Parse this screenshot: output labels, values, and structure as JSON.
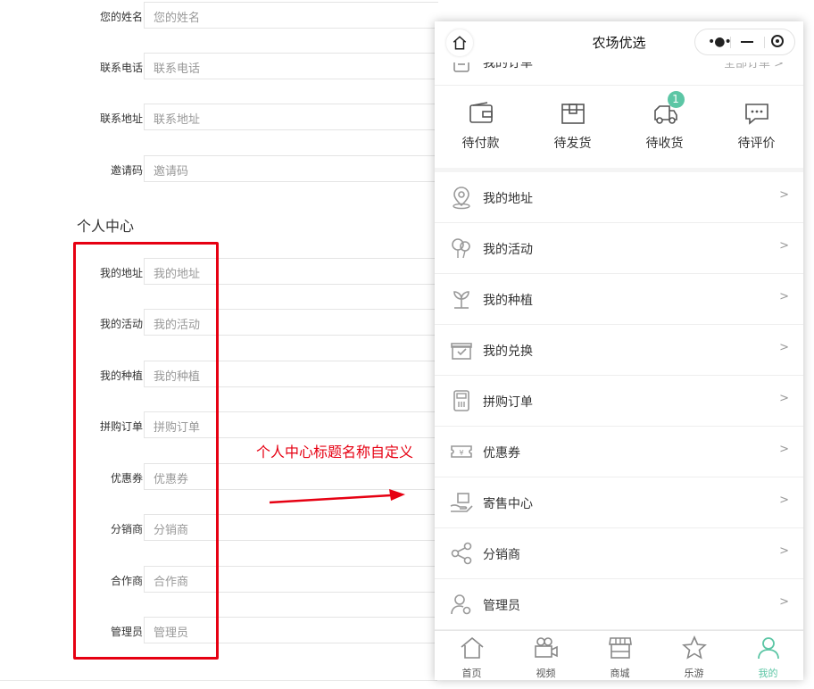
{
  "form": {
    "fields": [
      {
        "label": "您的姓名",
        "placeholder": "您的姓名"
      },
      {
        "label": "联系电话",
        "placeholder": "联系电话"
      },
      {
        "label": "联系地址",
        "placeholder": "联系地址"
      },
      {
        "label": "邀请码",
        "placeholder": "邀请码"
      }
    ],
    "section_title": "个人中心",
    "center_fields": [
      {
        "label": "我的地址",
        "placeholder": "我的地址"
      },
      {
        "label": "我的活动",
        "placeholder": "我的活动"
      },
      {
        "label": "我的种植",
        "placeholder": "我的种植"
      },
      {
        "label": "拼购订单",
        "placeholder": "拼购订单"
      },
      {
        "label": "优惠券",
        "placeholder": "优惠券"
      },
      {
        "label": "分销商",
        "placeholder": "分销商"
      },
      {
        "label": "合作商",
        "placeholder": "合作商"
      },
      {
        "label": "管理员",
        "placeholder": "管理员"
      }
    ]
  },
  "annotation": {
    "text": "个人中心标题名称自定义",
    "color": "#e60012"
  },
  "phone": {
    "title": "农场优选",
    "order_header": {
      "title": "我的订单",
      "all": "全部订单 >"
    },
    "orders": [
      {
        "label": "待付款",
        "icon": "wallet-icon"
      },
      {
        "label": "待发货",
        "icon": "package-icon"
      },
      {
        "label": "待收货",
        "icon": "delivery-truck-icon",
        "badge": "1"
      },
      {
        "label": "待评价",
        "icon": "comment-icon"
      }
    ],
    "menu": [
      {
        "label": "我的地址",
        "arrow": ">",
        "icon": "location-icon"
      },
      {
        "label": "我的活动",
        "arrow": ">",
        "icon": "balloon-icon"
      },
      {
        "label": "我的种植",
        "arrow": ">",
        "icon": "sprout-icon"
      },
      {
        "label": "我的兑换",
        "arrow": ">",
        "icon": "gift-icon"
      },
      {
        "label": "拼购订单",
        "arrow": ">",
        "icon": "receipt-icon"
      },
      {
        "label": "优惠券",
        "arrow": ">",
        "icon": "coupon-icon"
      },
      {
        "label": "寄售中心",
        "arrow": ">",
        "icon": "consign-icon"
      },
      {
        "label": "分销商",
        "arrow": ">",
        "icon": "share-icon"
      },
      {
        "label": "管理员",
        "arrow": ">",
        "icon": "admin-user-icon"
      }
    ],
    "tabs": [
      {
        "label": "首页",
        "icon": "home-icon"
      },
      {
        "label": "视频",
        "icon": "video-camera-icon"
      },
      {
        "label": "商城",
        "icon": "shop-icon"
      },
      {
        "label": "乐游",
        "icon": "star-icon"
      },
      {
        "label": "我的",
        "icon": "profile-icon",
        "active": true
      }
    ]
  },
  "colors": {
    "accent": "#5cc6a5",
    "annotation": "#e60012"
  }
}
